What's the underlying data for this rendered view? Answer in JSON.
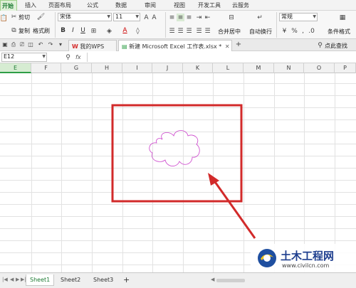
{
  "ribbon_tabs": [
    "开始",
    "插入",
    "页面布局",
    "公式",
    "数据",
    "审阅",
    "视图",
    "开发工具",
    "云服务"
  ],
  "ribbon": {
    "cut": "剪切",
    "copy": "复制",
    "format_painter": "格式刷",
    "font_name": "宋体",
    "font_size": "11",
    "bold": "B",
    "italic": "I",
    "underline": "U",
    "font_color": "A",
    "merge_center": "合并居中",
    "wrap_text": "自动换行",
    "number_format": "常规",
    "cond_format": "条件格式"
  },
  "doc_tabs": {
    "wps_home": "我的WPS",
    "active_file": "新建 Microsoft Excel 工作表.xlsx *",
    "add_tab": "+",
    "help_search": "点此查找"
  },
  "formula_bar": {
    "name_box": "E12",
    "fx": "fx",
    "formula": ""
  },
  "columns": [
    "E",
    "F",
    "G",
    "H",
    "I",
    "J",
    "K",
    "L",
    "M",
    "N",
    "O",
    "P"
  ],
  "selected_column": "E",
  "sheet_tabs": [
    "Sheet1",
    "Sheet2",
    "Sheet3"
  ],
  "active_sheet": "Sheet1",
  "add_sheet": "+",
  "watermark": {
    "title": "土木工程网",
    "url": "www.civilcn.com"
  },
  "colors": {
    "accent": "#2e9e46",
    "highlight_box": "#d22a2a",
    "arrow": "#d22a2a",
    "cloud_shape": "#cc44cc"
  }
}
